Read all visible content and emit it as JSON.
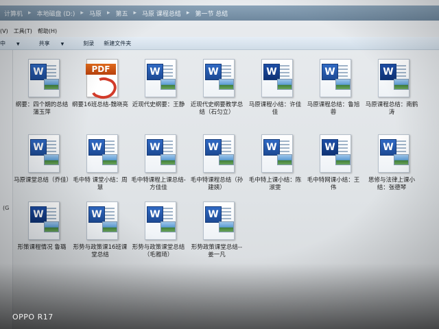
{
  "address_bar": {
    "crumbs": [
      "计算机",
      "本地磁盘 (D:)",
      "马原",
      "第五",
      "马原 课程总结",
      "第一节 总结"
    ]
  },
  "menu": {
    "view": "(V)",
    "tools": "工具(T)",
    "help": "帮助(H)"
  },
  "toolbar": {
    "include": "中",
    "share": "共享",
    "burn": "刻录",
    "new_folder": "新建文件夹"
  },
  "left_pane": {
    "group_char": "(G"
  },
  "files": [
    {
      "type": "word",
      "label": "纲要：四个期的总结 蒲玉萍"
    },
    {
      "type": "pdf",
      "label": "纲要16班总结-魏晓亮"
    },
    {
      "type": "word",
      "label": "近现代史纲要：王静"
    },
    {
      "type": "word",
      "label": "近现代史纲要教学总结（石匀立）"
    },
    {
      "type": "word-dark",
      "label": "马原课程小结：许佳佳"
    },
    {
      "type": "word",
      "label": "马原课程总结：鲁旭蓉"
    },
    {
      "type": "word-dark",
      "label": "马原课程总结：南鹤涛"
    },
    {
      "type": "word",
      "label": "马原课堂总结（乔佳）"
    },
    {
      "type": "word",
      "label": "毛中特 课堂小结：周慧"
    },
    {
      "type": "word",
      "label": "毛中特课程上课总结-方佳佳"
    },
    {
      "type": "word",
      "label": "毛中特课程总结（孙建姨）"
    },
    {
      "type": "word",
      "label": "毛中特上课小结：陈淑雯"
    },
    {
      "type": "word-dark",
      "label": "毛中特网课小结：王伟"
    },
    {
      "type": "word",
      "label": "思修与法律上课小结：张德琴"
    },
    {
      "type": "word-dark",
      "label": "形策课程情况 鲁璐"
    },
    {
      "type": "word",
      "label": "形势与政策课16班课堂总结"
    },
    {
      "type": "word",
      "label": "形势与政策课堂总结（毛雅琦）"
    },
    {
      "type": "word",
      "label": "形势政策课堂总结--姜一凡"
    }
  ],
  "watermark": "OPPO R17",
  "colors": {
    "word_blue": "#2f69c3",
    "pdf_orange": "#e06a1c",
    "toolbar": "#cfdce7"
  }
}
